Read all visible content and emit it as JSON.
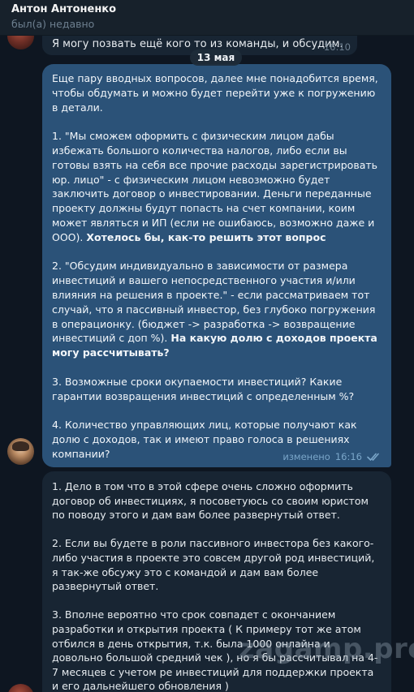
{
  "header": {
    "contact_name": "Антон Антоненко",
    "status": "был(а) недавно"
  },
  "previous_message": {
    "text": "Я могу позвать ещё кого то из команды, и обсудим.",
    "time": "16:10"
  },
  "date_separator": "13 мая",
  "outgoing_message": {
    "paragraphs": [
      {
        "text": "Еще пару вводных вопросов, далее мне понадобится время, чтобы обдумать и можно будет перейти уже к погружению в детали.",
        "bold": ""
      },
      {
        "text": "1. \"Мы сможем оформить с физическим лицом дабы избежать большого количества налогов, либо если вы готовы взять на себя все прочие расходы зарегистрировать юр. лицо\" - с физическим лицом невозможно будет заключить договор о инвестировании. Деньги переданные проекту должны будут попасть на счет компании, коим может являться и ИП (если не ошибаюсь, возможно даже и ООО). ",
        "bold": "Хотелось бы, как-то решить этот вопрос"
      },
      {
        "text": "2. \"Обсудим индивидуально в зависимости от размера инвестиций и вашего непосредственного участия и/или влияния на решения в проекте.\" - если рассматриваем тот случай, что я пассивный инвестор, без глубоко погружения в операционку. (бюджет -> разработка -> возвращение инвестиций с доп %). ",
        "bold": "На какую долю с доходов проекта могу рассчитывать?"
      },
      {
        "text": "3. Возможные сроки окупаемости инвестиций? Какие гарантии возвращения инвестиций с определенным %?",
        "bold": ""
      },
      {
        "text": "4. Количество управляющих лиц, которые получают как долю с доходов, так и имеют право голоса в решениях компании?",
        "bold": ""
      }
    ],
    "edited_label": "изменено",
    "time": "16:16",
    "status_icon": "double-check-icon"
  },
  "incoming_message": {
    "paragraphs": [
      "1. Дело в том что в этой сфере очень сложно оформить договор об инвестициях, я посоветуюсь со своим юристом по поводу этого и дам вам более развернутый ответ.",
      "2. Если вы будете в роли пассивного инвестора без какого-либо участия в проекте это совсем другой род инвестиций, я так-же обсужу это с командой и дам вам более развернутый ответ.",
      "3. Вполне вероятно что срок совпадет с окончанием разработки и открытия проекта ( К примеру тот же атом отбился в день открытия, т.к. была 1000 онлайна и довольно большой средний чек ), но я бы рассчитывал на 4-7 месяцев с учетом ре инвестиций для поддержки проекта и его дальнейшего обновления )"
    ]
  },
  "watermark": "zagamp.pro",
  "colors": {
    "background": "#0e1621",
    "header": "#17212b",
    "outgoing_bubble": "#2b5278",
    "incoming_bubble": "#182533",
    "meta_text": "#7aa6c9"
  }
}
